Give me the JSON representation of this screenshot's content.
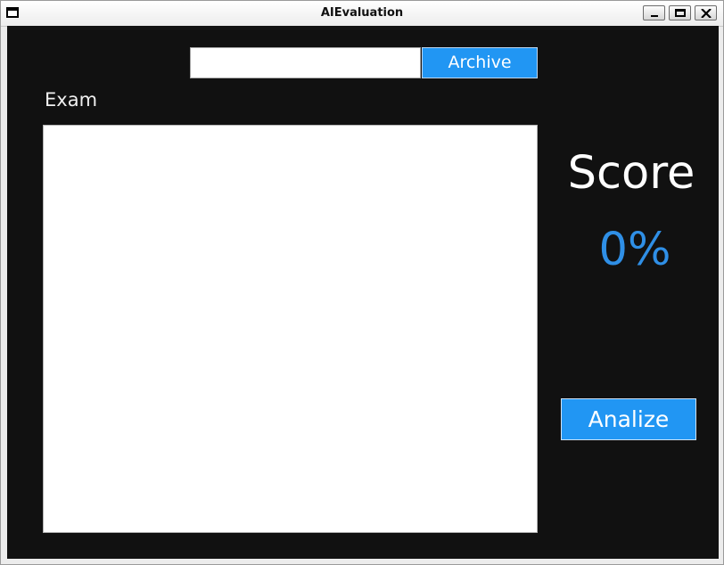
{
  "window": {
    "title": "AIEvaluation"
  },
  "file_picker": {
    "path_value": "",
    "button_label": "Archive"
  },
  "exam": {
    "label": "Exam",
    "text": ""
  },
  "score": {
    "label": "Score",
    "value": "0%"
  },
  "actions": {
    "analize_label": "Analize"
  },
  "colors": {
    "accent": "#2196f3",
    "score_value": "#2f8fe6",
    "background": "#111111"
  }
}
